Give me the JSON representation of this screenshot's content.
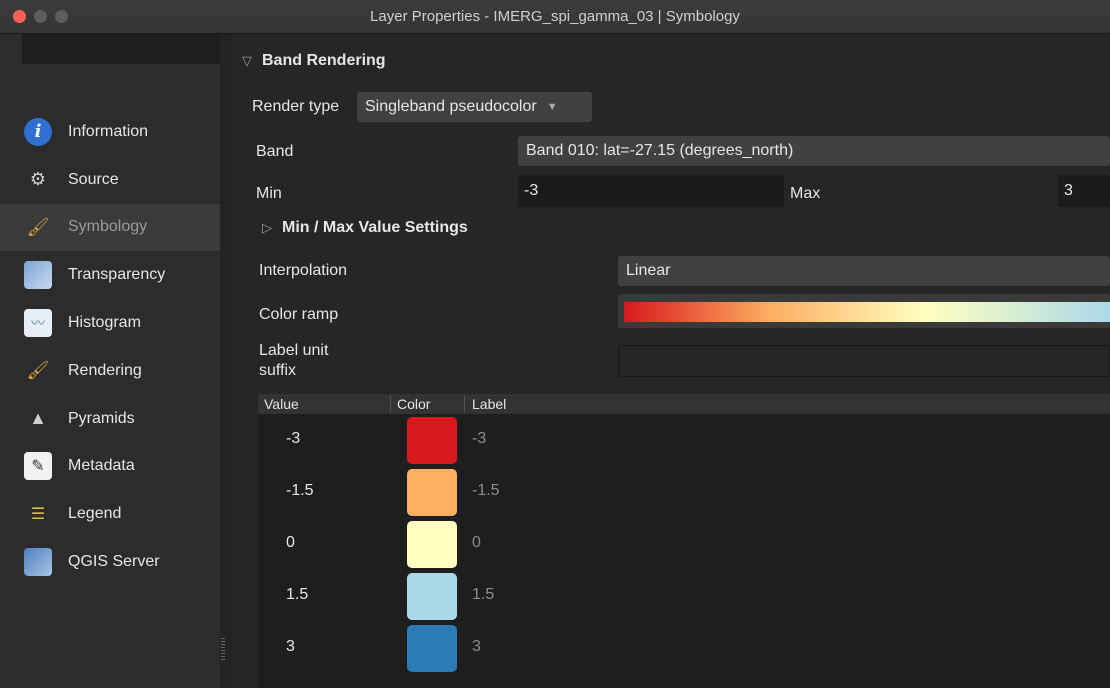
{
  "window": {
    "title": "Layer Properties - IMERG_spi_gamma_03 | Symbology"
  },
  "sidebar": {
    "search_placeholder": "",
    "items": [
      {
        "label": "Information",
        "icon": "info-icon"
      },
      {
        "label": "Source",
        "icon": "source-icon"
      },
      {
        "label": "Symbology",
        "icon": "symbology-brush-icon",
        "active": true
      },
      {
        "label": "Transparency",
        "icon": "transparency-icon"
      },
      {
        "label": "Histogram",
        "icon": "histogram-icon"
      },
      {
        "label": "Rendering",
        "icon": "rendering-brush-icon"
      },
      {
        "label": "Pyramids",
        "icon": "pyramids-icon"
      },
      {
        "label": "Metadata",
        "icon": "metadata-icon"
      },
      {
        "label": "Legend",
        "icon": "legend-icon"
      },
      {
        "label": "QGIS Server",
        "icon": "qgis-server-icon"
      }
    ]
  },
  "band_rendering": {
    "title": "Band Rendering",
    "render_type_label": "Render type",
    "render_type_value": "Singleband pseudocolor",
    "band_label": "Band",
    "band_value": "Band 010: lat=-27.15 (degrees_north)",
    "min_label": "Min",
    "min_value": "-3",
    "max_label": "Max",
    "max_value": "3",
    "minmax_settings_label": "Min / Max Value Settings",
    "interpolation_label": "Interpolation",
    "interpolation_value": "Linear",
    "color_ramp_label": "Color ramp",
    "label_unit_suffix_label_1": "Label unit",
    "label_unit_suffix_label_2": "suffix",
    "label_unit_suffix_value": ""
  },
  "color_table": {
    "headers": {
      "value": "Value",
      "color": "Color",
      "label": "Label"
    },
    "rows": [
      {
        "value": "-3",
        "color": "#d7191c",
        "label": "-3"
      },
      {
        "value": "-1.5",
        "color": "#fdae61",
        "label": "-1.5"
      },
      {
        "value": "0",
        "color": "#ffffbf",
        "label": "0"
      },
      {
        "value": "1.5",
        "color": "#abd9e9",
        "label": "1.5"
      },
      {
        "value": "3",
        "color": "#2c7bb6",
        "label": "3"
      }
    ]
  }
}
